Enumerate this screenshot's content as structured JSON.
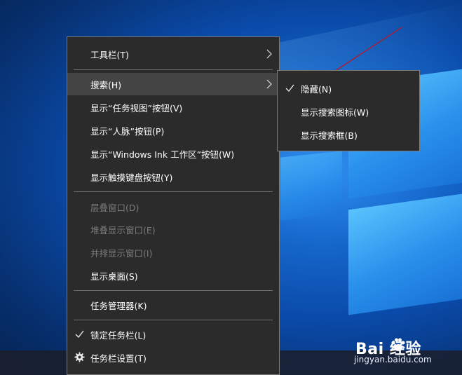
{
  "menu": {
    "items": [
      {
        "label": "工具栏(T)",
        "submenu": true,
        "enabled": true
      },
      {
        "label": "搜索(H)",
        "submenu": true,
        "enabled": true,
        "highlighted": true
      },
      {
        "label": "显示“任务视图”按钮(V)",
        "enabled": true
      },
      {
        "label": "显示“人脉”按钮(P)",
        "enabled": true
      },
      {
        "label": "显示“Windows Ink 工作区”按钮(W)",
        "enabled": true
      },
      {
        "label": "显示触摸键盘按钮(Y)",
        "enabled": true
      },
      {
        "label": "层叠窗口(D)",
        "enabled": false
      },
      {
        "label": "堆叠显示窗口(E)",
        "enabled": false
      },
      {
        "label": "并排显示窗口(I)",
        "enabled": false
      },
      {
        "label": "显示桌面(S)",
        "enabled": true
      },
      {
        "label": "任务管理器(K)",
        "enabled": true
      },
      {
        "label": "锁定任务栏(L)",
        "enabled": true,
        "checked": true,
        "icon": "check-icon"
      },
      {
        "label": "任务栏设置(T)",
        "enabled": true,
        "icon": "gear-icon"
      }
    ]
  },
  "submenu": {
    "items": [
      {
        "label": "隐藏(N)",
        "checked": true,
        "icon": "check-icon"
      },
      {
        "label": "显示搜索图标(W)",
        "checked": false
      },
      {
        "label": "显示搜索框(B)",
        "checked": false
      }
    ]
  },
  "watermark": {
    "brand": "Bai  经验",
    "site": "jingyan.baidu.com"
  },
  "colors": {
    "menu_bg": "#2b2b2b",
    "highlight": "#444444",
    "disabled_text": "#7a7a7a",
    "annotation_arrow": "#c0141e"
  }
}
